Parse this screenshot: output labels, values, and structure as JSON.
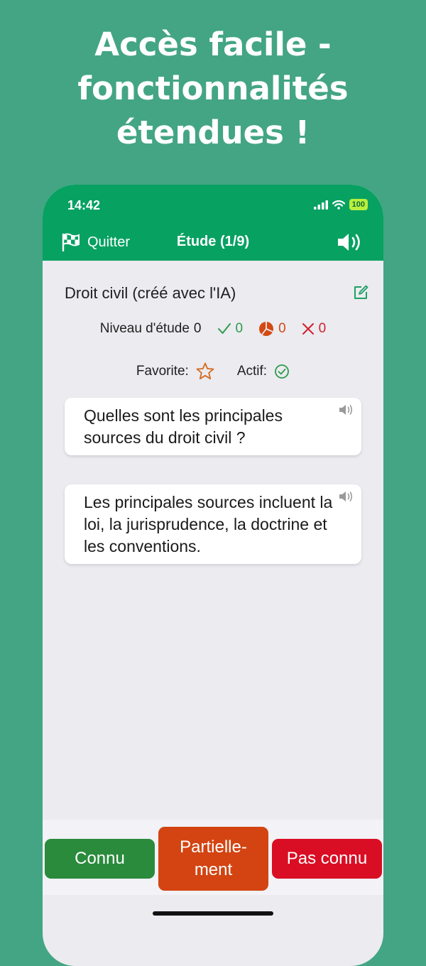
{
  "headline": {
    "line1": "Accès facile -",
    "line2": "fonctionnalités",
    "line3": "étendues !"
  },
  "status": {
    "time": "14:42",
    "battery": "100"
  },
  "nav": {
    "quit_label": "Quitter",
    "title": "Étude (1/9)"
  },
  "deck": {
    "title": "Droit civil (créé avec l'IA)"
  },
  "stats": {
    "level_label": "Niveau d'étude",
    "level_value": "0",
    "known_count": "0",
    "partial_count": "0",
    "unknown_count": "0"
  },
  "flags": {
    "favorite_label": "Favorite:",
    "active_label": "Actif:"
  },
  "card": {
    "question": "Quelles sont les principales sources du droit civil ?",
    "answer": "Les principales sources incluent la loi, la jurisprudence, la doctrine et les conventions."
  },
  "buttons": {
    "known": "Connu",
    "partial": "Partielle-ment",
    "unknown": "Pas connu"
  },
  "colors": {
    "background": "#43a583",
    "header": "#07a162",
    "known": "#2a8b3d",
    "partial": "#d34412",
    "unknown": "#d90e24"
  }
}
